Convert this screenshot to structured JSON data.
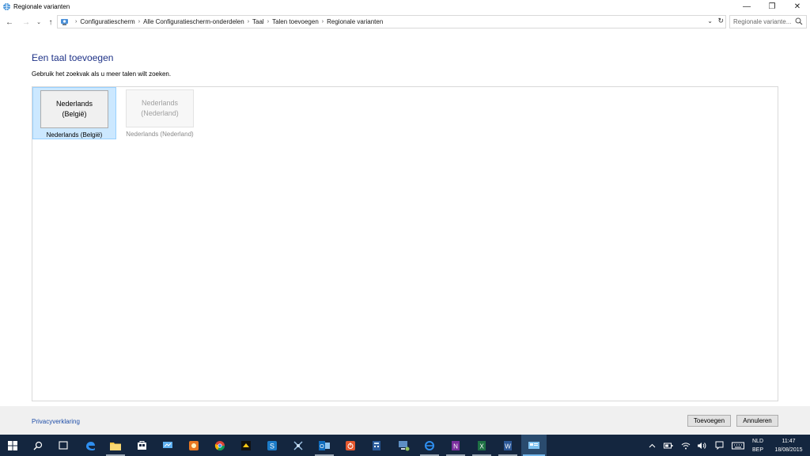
{
  "window": {
    "title": "Regionale varianten",
    "minimize_glyph": "—",
    "restore_glyph": "❐",
    "close_glyph": "✕"
  },
  "addressbar": {
    "back_glyph": "←",
    "forward_glyph": "→",
    "recent_glyph": "⌄",
    "up_glyph": "↑",
    "breadcrumbs": [
      "Configuratiescherm",
      "Alle Configuratiescherm-onderdelen",
      "Taal",
      "Talen toevoegen",
      "Regionale varianten"
    ],
    "separator": "›",
    "dropdown_glyph": "⌄",
    "refresh_glyph": "↻",
    "search_placeholder": "Regionale variante..."
  },
  "main": {
    "heading": "Een taal toevoegen",
    "subtext": "Gebruik het zoekvak als u meer talen wilt zoeken.",
    "languages": [
      {
        "line1": "Nederlands",
        "line2": "(België)",
        "caption": "Nederlands (België)",
        "state": "selected"
      },
      {
        "line1": "Nederlands",
        "line2": "(Nederland)",
        "caption": "Nederlands (Nederland)",
        "state": "disabled"
      }
    ]
  },
  "footer": {
    "privacy_link": "Privacyverklaring",
    "add_button": "Toevoegen",
    "cancel_button": "Annuleren"
  },
  "taskbar": {
    "apps": [
      "windows-start-icon",
      "search-icon",
      "task-view-icon",
      "edge-icon",
      "file-explorer-icon",
      "store-icon",
      "remote-desktop-icon",
      "paint-app-icon",
      "chrome-icon",
      "sticky-app-icon",
      "skype-business-icon",
      "network-tool-icon",
      "outlook-icon",
      "power-app-icon",
      "calculator-icon",
      "network-computer-icon",
      "internet-explorer-icon",
      "onenote-icon",
      "excel-icon",
      "word-icon",
      "control-panel-icon"
    ],
    "tray": {
      "language_line1": "NLD",
      "language_line2": "BEP",
      "time": "11:47",
      "date": "18/08/2015"
    },
    "colors": {
      "background": "#14263f",
      "active_indicator": "#76b9ed"
    }
  },
  "colors": {
    "heading": "#1e3287",
    "link": "#1f4ea8",
    "selection_fill": "#cce8ff",
    "selection_border": "#99d1ff"
  }
}
